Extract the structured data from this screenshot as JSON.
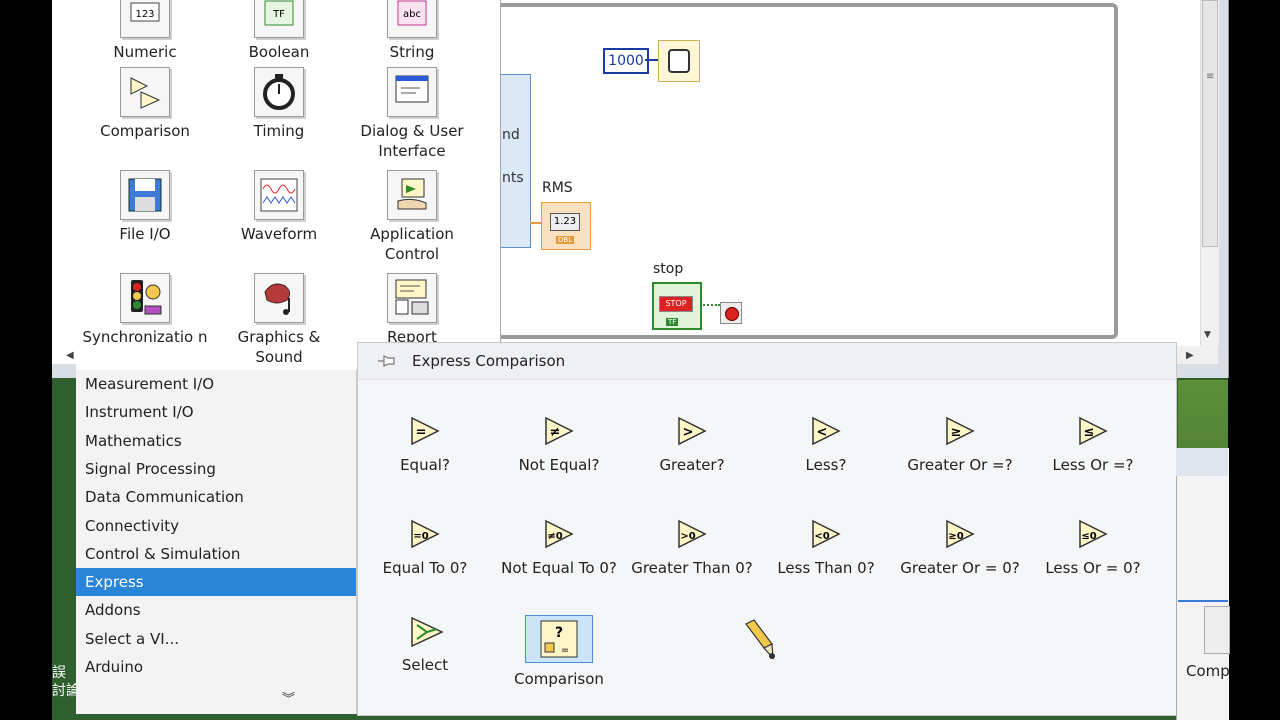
{
  "block_diagram": {
    "constant_value": "1000",
    "node_text_1": "nd",
    "node_text_2": "nts",
    "rms_label": "RMS",
    "rms_indicator_value": "1.23",
    "rms_indicator_type": "DBL",
    "stop_label": "stop",
    "stop_button_text": "STOP",
    "stop_type": "TF"
  },
  "palette": {
    "items": [
      {
        "label": "Numeric",
        "icon": "numeric-icon"
      },
      {
        "label": "Boolean",
        "icon": "boolean-icon"
      },
      {
        "label": "String",
        "icon": "string-icon"
      },
      {
        "label": "Comparison",
        "icon": "comparison-icon"
      },
      {
        "label": "Timing",
        "icon": "stopwatch-icon"
      },
      {
        "label": "Dialog & User Interface",
        "icon": "dialog-icon"
      },
      {
        "label": "File I/O",
        "icon": "floppy-disk-icon"
      },
      {
        "label": "Waveform",
        "icon": "waveform-icon"
      },
      {
        "label": "Application Control",
        "icon": "application-control-icon"
      },
      {
        "label": "Synchronizatio n",
        "icon": "traffic-light-icon"
      },
      {
        "label": "Graphics & Sound",
        "icon": "graphics-sound-icon"
      },
      {
        "label": "Report",
        "icon": "report-icon"
      }
    ]
  },
  "categories": [
    "Measurement I/O",
    "Instrument I/O",
    "Mathematics",
    "Signal Processing",
    "Data Communication",
    "Connectivity",
    "Control & Simulation",
    "Express",
    "Addons",
    "Select a VI...",
    "Arduino"
  ],
  "selected_category": "Express",
  "express_palette": {
    "title": "Express Comparison",
    "items": [
      {
        "label": "Equal?",
        "glyph": "="
      },
      {
        "label": "Not Equal?",
        "glyph": "≠"
      },
      {
        "label": "Greater?",
        "glyph": ">"
      },
      {
        "label": "Less?",
        "glyph": "<"
      },
      {
        "label": "Greater Or =?",
        "glyph": "≥"
      },
      {
        "label": "Less Or =?",
        "glyph": "≤"
      },
      {
        "label": "Equal To 0?",
        "glyph": "=0"
      },
      {
        "label": "Not Equal To 0?",
        "glyph": "≠0"
      },
      {
        "label": "Greater Than 0?",
        "glyph": ">0"
      },
      {
        "label": "Less Than 0?",
        "glyph": "<0"
      },
      {
        "label": "Greater Or = 0?",
        "glyph": "≥0"
      },
      {
        "label": "Less Or = 0?",
        "glyph": "≤0"
      },
      {
        "label": "Select",
        "glyph": "select"
      },
      {
        "label": "Comparison",
        "glyph": "comparison-express"
      }
    ]
  },
  "right_window": {
    "label": "Comp"
  },
  "left_glyphs": "誤\n討論"
}
